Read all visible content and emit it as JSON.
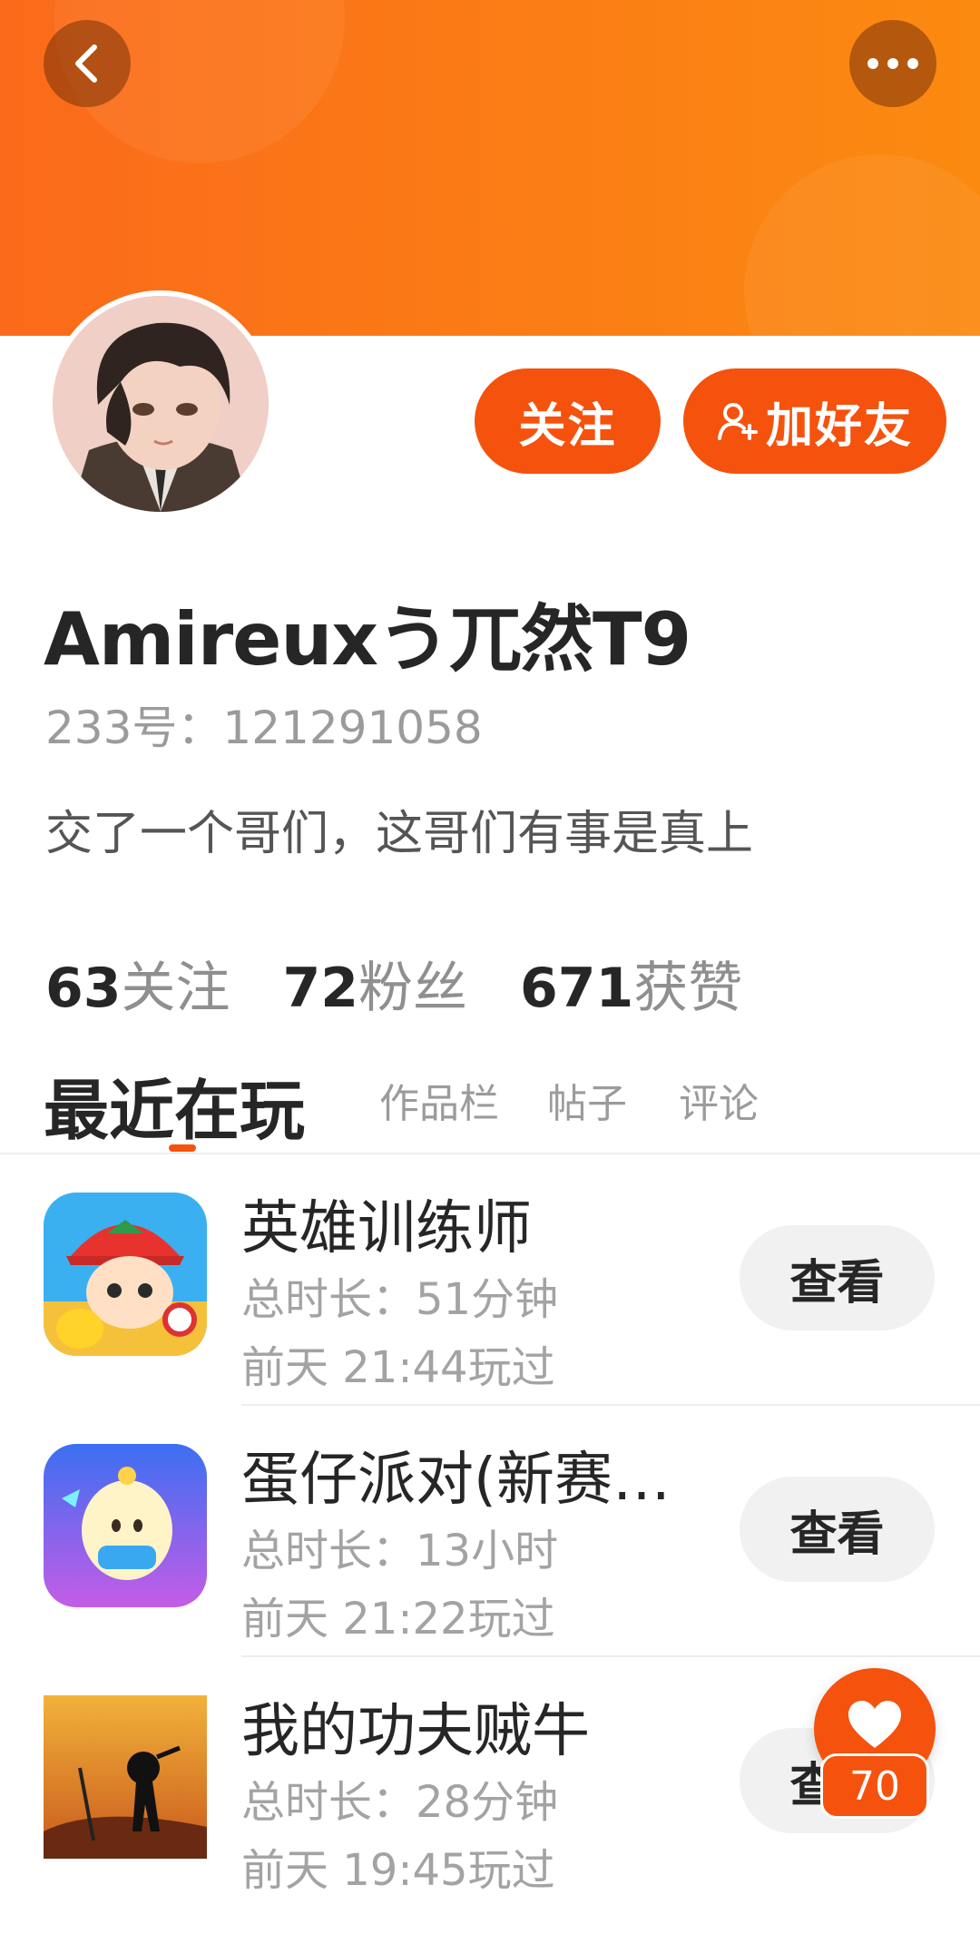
{
  "profile": {
    "name": "Amireuxう兀然T9",
    "uid": "233号：121291058",
    "bio": "交了一个哥们，这哥们有事是真上"
  },
  "actions": {
    "follow_label": "关注",
    "add_friend_label": "加好友"
  },
  "stats": [
    {
      "value": "63",
      "label": "关注"
    },
    {
      "value": "72",
      "label": "粉丝"
    },
    {
      "value": "671",
      "label": "获赞"
    }
  ],
  "tabs": {
    "active": "最近在玩",
    "items": [
      "作品栏",
      "帖子",
      "评论"
    ]
  },
  "games": [
    {
      "title": "英雄训练师",
      "duration": "总时长：51分钟",
      "last_played": "前天 21:44玩过",
      "button": "查看"
    },
    {
      "title": "蛋仔派对(新赛…",
      "duration": "总时长：13小时",
      "last_played": "前天 21:22玩过",
      "button": "查看"
    },
    {
      "title": "我的功夫贼牛",
      "duration": "总时长：28分钟",
      "last_played": "前天 19:45玩过",
      "button": "查看"
    }
  ],
  "like": {
    "count": "70"
  },
  "icons": {
    "back": "chevron-left-icon",
    "more": "more-dots-icon",
    "add_friend": "add-user-icon",
    "like": "heart-icon"
  },
  "colors": {
    "header_orange": "#fb7d15",
    "accent": "#f5520d",
    "button_gray": "#f1f1f1"
  }
}
